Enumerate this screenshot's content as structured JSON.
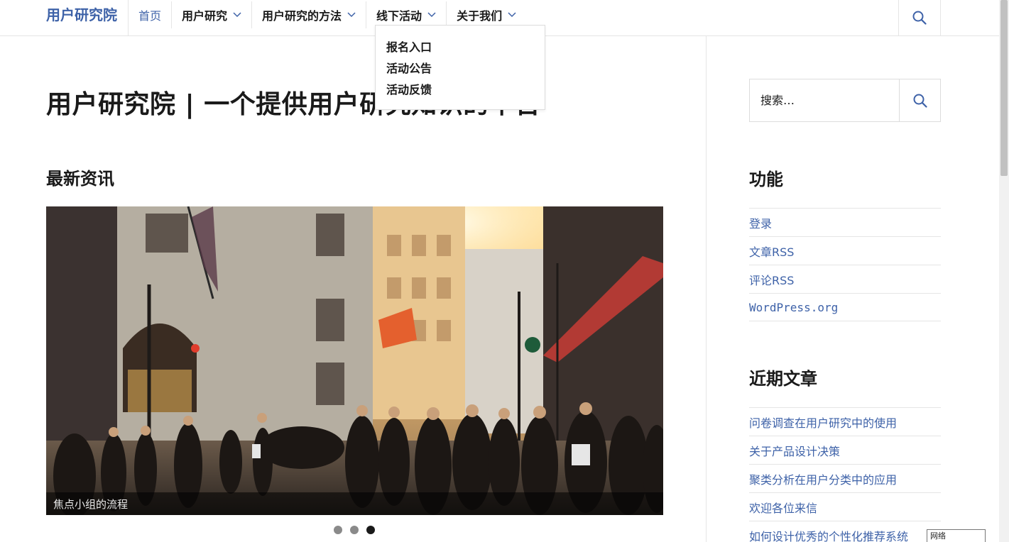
{
  "brand": {
    "name": "用户研究院"
  },
  "nav": {
    "items": [
      {
        "label": "首页"
      },
      {
        "label": "用户研究"
      },
      {
        "label": "用户研究的方法"
      },
      {
        "label": "线下活动"
      },
      {
        "label": "关于我们"
      }
    ],
    "dropdown": [
      "报名入口",
      "活动公告",
      "活动反馈"
    ]
  },
  "main": {
    "title": "用户研究院 | 一个提供用户研究知识的平台",
    "section_heading": "最新资讯",
    "slider": {
      "caption": "焦点小组的流程",
      "dots": 3,
      "active_dot": 3
    }
  },
  "sidebar": {
    "search_placeholder": "搜索…",
    "functions": {
      "title": "功能",
      "links": {
        "login": "登录",
        "entries_rss": "文章RSS",
        "comments_rss": "评论RSS",
        "wordpress": "WordPress.org"
      }
    },
    "recent": {
      "title": "近期文章",
      "posts": [
        "问卷调查在用户研究中的使用",
        "关于产品设计决策",
        "聚类分析在用户分类中的应用",
        "欢迎各位来信",
        "如何设计优秀的个性化推荐系统"
      ]
    }
  },
  "overlay": {
    "network_tooltip": "网络"
  },
  "colors": {
    "link": "#3e62a8",
    "text": "#1a1a1a",
    "border": "#e5e5e5"
  },
  "icons": {
    "search": "search-icon",
    "chevron": "chevron-down-icon"
  }
}
